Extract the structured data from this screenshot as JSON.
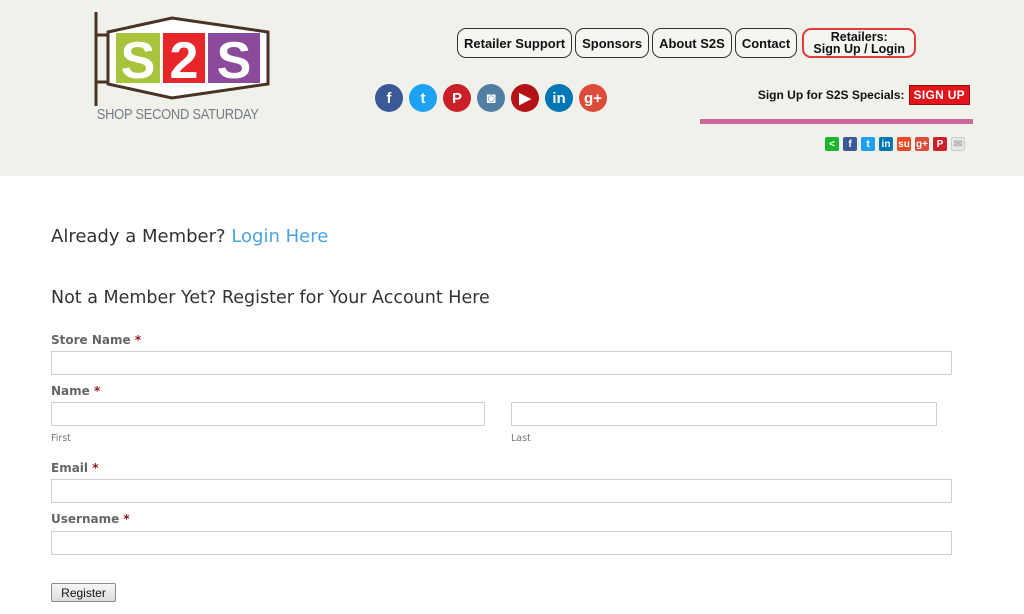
{
  "header": {
    "logo": {
      "letters": [
        "S",
        "2",
        "S"
      ],
      "colors": [
        "#a8c43c",
        "#e8262a",
        "#8b4a9c"
      ],
      "tagline": "SHOP SECOND SATURDAY"
    },
    "nav": [
      {
        "label": "Retailer Support"
      },
      {
        "label": "Sponsors"
      },
      {
        "label": "About S2S"
      },
      {
        "label": "Contact"
      }
    ],
    "retailers_button": {
      "line1": "Retailers:",
      "line2": "Sign Up / Login"
    },
    "social": [
      {
        "name": "facebook",
        "glyph": "f",
        "color": "#3b5998"
      },
      {
        "name": "twitter",
        "glyph": "t",
        "color": "#1da1f2"
      },
      {
        "name": "pinterest",
        "glyph": "P",
        "color": "#cb2027"
      },
      {
        "name": "instagram",
        "glyph": "◙",
        "color": "#517fa4"
      },
      {
        "name": "youtube",
        "glyph": "▶",
        "color": "#b31217"
      },
      {
        "name": "linkedin",
        "glyph": "in",
        "color": "#0077b5"
      },
      {
        "name": "google-plus",
        "glyph": "g+",
        "color": "#dd4b39"
      }
    ],
    "specials_label": "Sign Up for S2S Specials:",
    "signup_button": "SIGN UP",
    "share": [
      {
        "name": "share",
        "glyph": "<",
        "color": "#1bb52f"
      },
      {
        "name": "facebook",
        "glyph": "f",
        "color": "#3b5998"
      },
      {
        "name": "twitter",
        "glyph": "t",
        "color": "#1da1f2"
      },
      {
        "name": "linkedin",
        "glyph": "in",
        "color": "#0077b5"
      },
      {
        "name": "stumbleupon",
        "glyph": "su",
        "color": "#eb4924"
      },
      {
        "name": "google-plus",
        "glyph": "g+",
        "color": "#dd4b39"
      },
      {
        "name": "pinterest",
        "glyph": "P",
        "color": "#cb2027"
      },
      {
        "name": "email",
        "glyph": "✉",
        "color": "#e6e6e6"
      }
    ]
  },
  "main": {
    "already_text": "Already a Member?",
    "login_link": "Login Here",
    "register_title": "Not a Member Yet? Register for Your Account Here",
    "form": {
      "store_name_label": "Store Name",
      "name_label": "Name",
      "first_sublabel": "First",
      "last_sublabel": "Last",
      "email_label": "Email",
      "username_label": "Username",
      "required_mark": "*",
      "store_name_value": "",
      "first_value": "",
      "last_value": "",
      "email_value": "",
      "username_value": "",
      "submit_label": "Register"
    }
  }
}
